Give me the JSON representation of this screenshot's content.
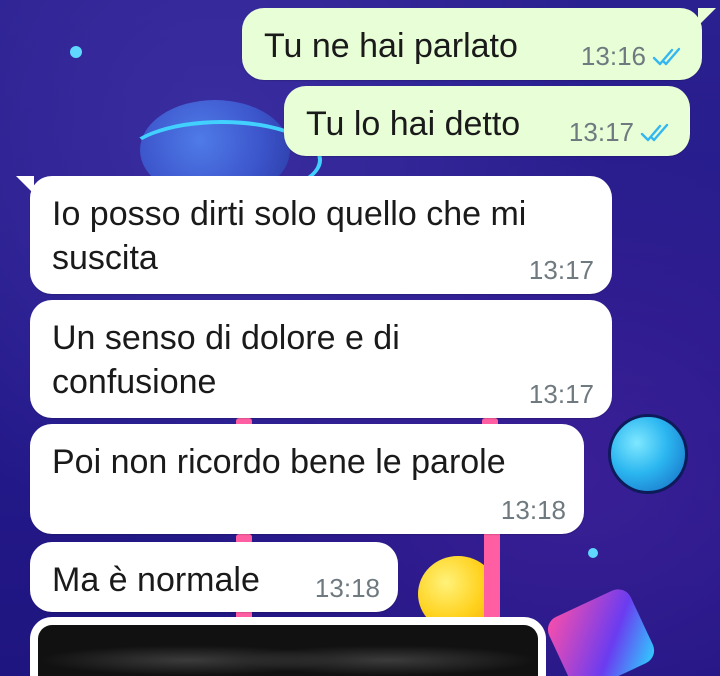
{
  "chat": {
    "messages": [
      {
        "direction": "outgoing",
        "text": "Tu ne hai parlato",
        "time": "13:16",
        "status": "read"
      },
      {
        "direction": "outgoing",
        "text": "Tu lo hai detto",
        "time": "13:17",
        "status": "read"
      },
      {
        "direction": "incoming",
        "text": "Io posso dirti solo quello che mi suscita",
        "time": "13:17"
      },
      {
        "direction": "incoming",
        "text": "Un senso di dolore e di confusione",
        "time": "13:17"
      },
      {
        "direction": "incoming",
        "text": "Poi non ricordo bene le parole",
        "time": "13:18"
      },
      {
        "direction": "incoming",
        "text": "Ma è normale",
        "time": "13:18"
      }
    ],
    "media_message": {
      "direction": "incoming",
      "type": "image"
    }
  },
  "colors": {
    "outgoing_bubble": "#e7fed6",
    "incoming_bubble": "#ffffff",
    "read_tick": "#34b7f1",
    "wallpaper": "#2a1f86"
  }
}
